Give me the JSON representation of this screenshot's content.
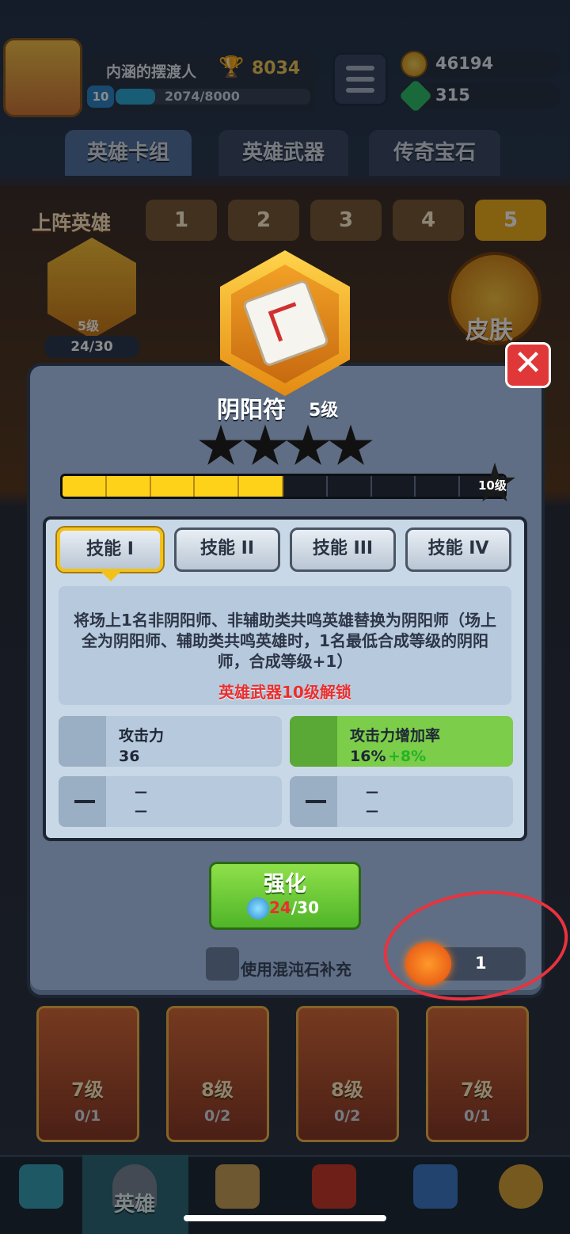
{
  "player": {
    "name": "内涵的摆渡人",
    "level": "10",
    "xp": "2074/8000",
    "trophies": "8034"
  },
  "currency": {
    "coins": "46194",
    "gems": "315"
  },
  "tabs": [
    {
      "label": "英雄卡组"
    },
    {
      "label": "英雄武器"
    },
    {
      "label": "传奇宝石"
    }
  ],
  "lineup": {
    "label": "上阵英雄",
    "slots": [
      "1",
      "2",
      "3",
      "4",
      "5"
    ],
    "active_slot": "5"
  },
  "equipped": {
    "level": "5级",
    "progress": "24/30"
  },
  "skin": {
    "label": "皮肤"
  },
  "weapon": {
    "name": "阴阳符",
    "level": "5级",
    "stars_filled": 0,
    "stars_total": 4,
    "progress_segments_filled": 5,
    "progress_segments_total": 10,
    "max_level": "10级"
  },
  "skills": [
    {
      "label": "技能 I"
    },
    {
      "label": "技能 II"
    },
    {
      "label": "技能 III"
    },
    {
      "label": "技能 IV"
    }
  ],
  "skill_desc": "将场上1名非阴阳师、非辅助类共鸣英雄替换为阴阳师（场上全为阴阳师、辅助类共鸣英雄时，1名最低合成等级的阴阳师，合成等级+1）",
  "unlock_note": "英雄武器10级解锁",
  "stats": [
    {
      "name": "攻击力",
      "value": "36",
      "bonus": ""
    },
    {
      "name": "攻击力增加率",
      "value": "16%",
      "bonus": "+8%"
    },
    {
      "name": "—",
      "value": "—",
      "bonus": ""
    },
    {
      "name": "—",
      "value": "—",
      "bonus": ""
    }
  ],
  "upgrade": {
    "label": "强化",
    "cost_have": "24",
    "cost_need": "/30"
  },
  "chaos": {
    "checkbox_label": "使用混沌石补充",
    "count": "1"
  },
  "cards": [
    {
      "level": "7级",
      "count": "0/1"
    },
    {
      "level": "8级",
      "count": "0/2"
    },
    {
      "level": "8级",
      "count": "0/2"
    },
    {
      "level": "7级",
      "count": "0/1"
    }
  ],
  "nav": {
    "active_label": "英雄"
  },
  "colors": {
    "accent_gold": "#f2c21a",
    "upgrade_green": "#4fb528",
    "close_red": "#e03838",
    "annotation_red": "#e8333f"
  }
}
